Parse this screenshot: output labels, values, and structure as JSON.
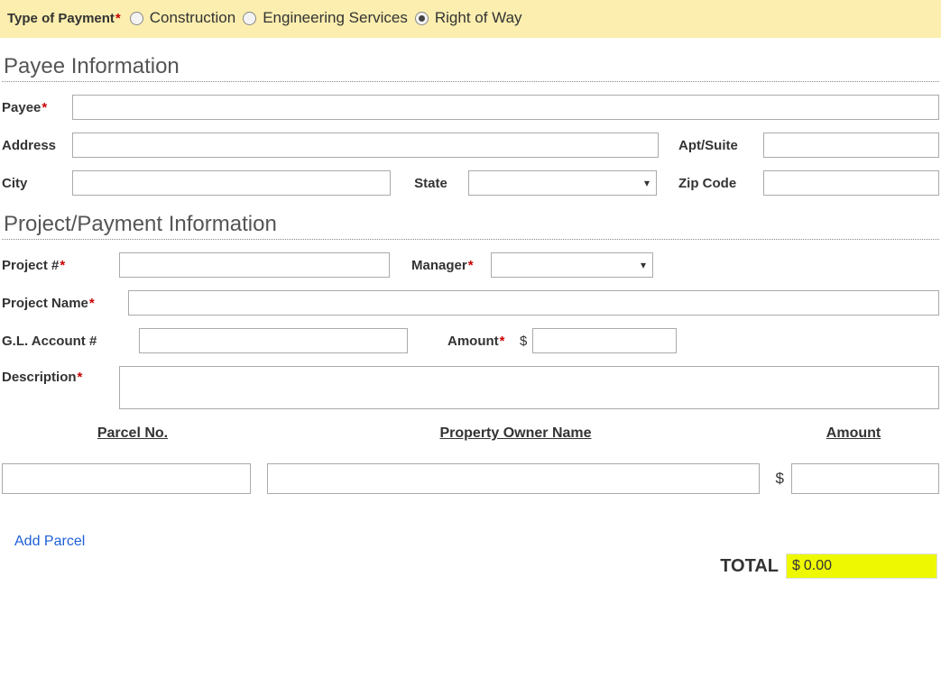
{
  "topbar": {
    "label": "Type of Payment",
    "options": [
      {
        "label": "Construction",
        "selected": false
      },
      {
        "label": "Engineering Services",
        "selected": false
      },
      {
        "label": "Right of Way",
        "selected": true
      }
    ]
  },
  "payee_section": {
    "title": "Payee Information",
    "payee_label": "Payee",
    "address_label": "Address",
    "apt_label": "Apt/Suite",
    "city_label": "City",
    "state_label": "State",
    "zip_label": "Zip Code"
  },
  "project_section": {
    "title": "Project/Payment Information",
    "project_num_label": "Project #",
    "manager_label": "Manager",
    "project_name_label": "Project Name",
    "gl_label": "G.L. Account #",
    "amount_label": "Amount",
    "description_label": "Description"
  },
  "parcel": {
    "col_parcel": "Parcel No.",
    "col_owner": "Property Owner Name",
    "col_amount": "Amount",
    "dollar": "$",
    "add_label": "Add Parcel"
  },
  "total": {
    "label": "TOTAL",
    "dollar": "$",
    "value": "0.00"
  }
}
